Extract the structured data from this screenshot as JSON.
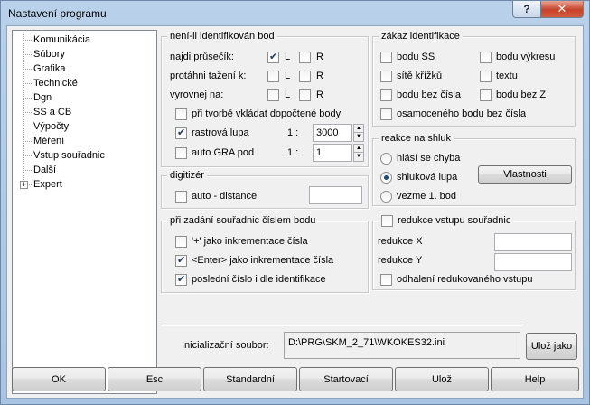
{
  "window": {
    "title": "Nastavení programu",
    "help_glyph": "?",
    "close_glyph": "✕"
  },
  "tree": {
    "items": [
      {
        "label": "Komunikácia"
      },
      {
        "label": "Súbory"
      },
      {
        "label": "Grafika"
      },
      {
        "label": "Technické"
      },
      {
        "label": "Dgn"
      },
      {
        "label": "SS a CB"
      },
      {
        "label": "Výpočty"
      },
      {
        "label": "Měření"
      },
      {
        "label": "Vstup souřadnic",
        "selected": true
      },
      {
        "label": "Další"
      },
      {
        "label": "Expert",
        "expandable": true
      }
    ],
    "expander_glyph": "+"
  },
  "identification": {
    "legend": "není-li identifikován bod",
    "rows": [
      {
        "label": "najdi průsečík:",
        "L": true,
        "R": false
      },
      {
        "label": "protáhni tažení k:",
        "L": false,
        "R": false
      },
      {
        "label": "vyrovnej na:",
        "L": false,
        "R": false
      }
    ],
    "col_L": "L",
    "col_R": "R",
    "vklada": {
      "label": "při tvorbě vkládat dopočtené body",
      "checked": false
    },
    "lupa": {
      "label": "rastrová lupa",
      "checked": true,
      "ratio_prefix": "1 :",
      "value": "3000"
    },
    "gra": {
      "label": "auto GRA pod",
      "checked": false,
      "ratio_prefix": "1 :",
      "value": "1"
    }
  },
  "ban": {
    "legend": "zákaz identifikace",
    "items": [
      {
        "label": "bodu SS",
        "checked": false
      },
      {
        "label": "bodu výkresu",
        "checked": false
      },
      {
        "label": "sítě křížků",
        "checked": false
      },
      {
        "label": "textu",
        "checked": false
      },
      {
        "label": "bodu bez čísla",
        "checked": false
      },
      {
        "label": "bodu bez Z",
        "checked": false
      },
      {
        "label": "osamoceného bodu bez čísla",
        "checked": false
      }
    ]
  },
  "cluster": {
    "legend": "reakce na shluk",
    "options": [
      {
        "label": "hlásí se chyba",
        "checked": false
      },
      {
        "label": "shluková lupa",
        "checked": true
      },
      {
        "label": "vezme 1. bod",
        "checked": false
      }
    ],
    "properties_button": "Vlastnosti"
  },
  "digitizer": {
    "legend": "digitizér",
    "auto_distance": {
      "label": "auto - distance",
      "checked": false,
      "value": ""
    }
  },
  "coord_number": {
    "legend": "při zadání souřadnic číslem bodu",
    "items": [
      {
        "label": "'+' jako inkrementace čísla",
        "checked": false
      },
      {
        "label": "<Enter> jako inkrementace čísla",
        "checked": true
      },
      {
        "label": "poslední číslo i dle identifikace",
        "checked": true
      }
    ]
  },
  "reduction": {
    "legend": "redukce vstupu souřadnic",
    "legend_checked": false,
    "x_label": "redukce X",
    "x_value": "",
    "y_label": "redukce Y",
    "y_value": "",
    "reveal": {
      "label": "odhalení redukovaného vstupu",
      "checked": false
    }
  },
  "init": {
    "label": "Inicializační soubor:",
    "path": "D:\\PRG\\SKM_2_71\\WKOKES32.ini",
    "save_as_button": "Ulož jako"
  },
  "buttons": {
    "ok": "OK",
    "esc": "Esc",
    "standard": "Standardní",
    "start": "Startovací",
    "save": "Ulož",
    "help": "Help"
  }
}
